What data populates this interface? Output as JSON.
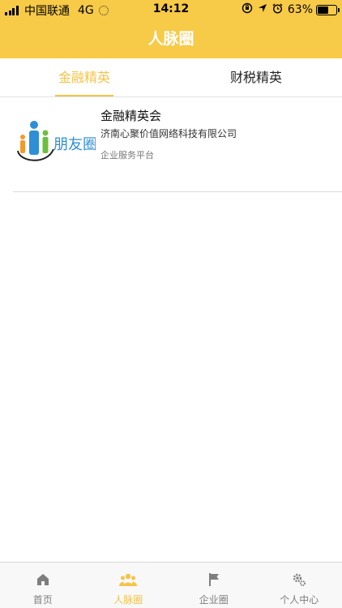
{
  "status_bar": {
    "carrier": "中国联通",
    "network": "4G",
    "time": "14:12",
    "battery_percent": "63%",
    "battery_level": 0.63,
    "signal_bars": 4
  },
  "nav": {
    "title": "人脉圈"
  },
  "tabs": [
    {
      "label": "金融精英",
      "active": true
    },
    {
      "label": "财税精英",
      "active": false
    }
  ],
  "list": [
    {
      "title": "金融精英会",
      "company": "济南心聚价值网络科技有限公司",
      "tag": "企业服务平台",
      "logo_text": "朋友圈"
    }
  ],
  "tabbar": [
    {
      "label": "首页",
      "icon": "home-icon",
      "active": false
    },
    {
      "label": "人脉圈",
      "icon": "people-icon",
      "active": true
    },
    {
      "label": "企业圈",
      "icon": "flag-icon",
      "active": false
    },
    {
      "label": "个人中心",
      "icon": "gear-icon",
      "active": false
    }
  ],
  "colors": {
    "accent": "#f7ca47",
    "active_text": "#f5c446",
    "inactive": "#7e7e7e"
  }
}
